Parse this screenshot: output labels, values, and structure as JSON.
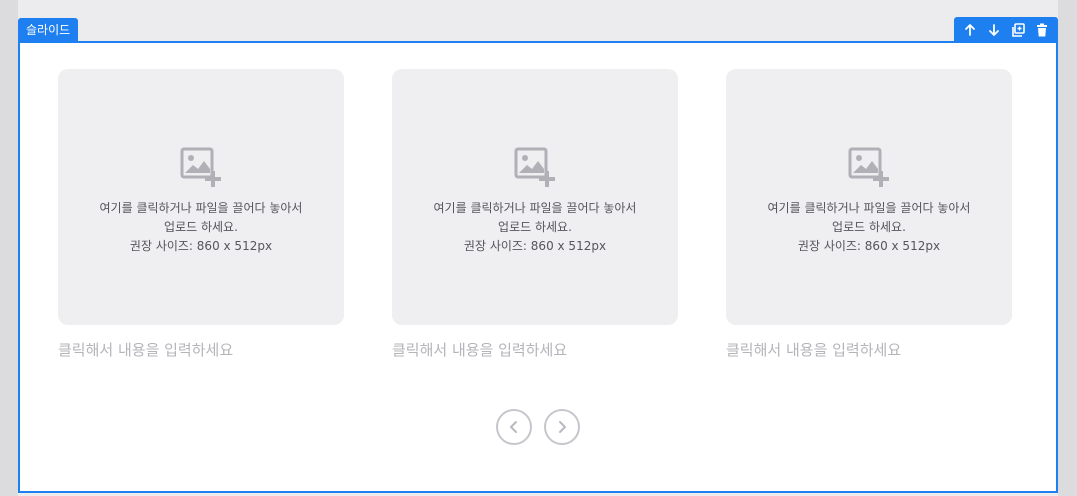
{
  "block": {
    "tag_label": "슬라이드"
  },
  "toolbar": {
    "items": [
      {
        "icon": "arrow-up-icon"
      },
      {
        "icon": "arrow-down-icon"
      },
      {
        "icon": "duplicate-icon"
      },
      {
        "icon": "trash-icon"
      }
    ]
  },
  "slides": [
    {
      "upload_line1": "여기를 클릭하거나 파일을 끌어다 놓아서",
      "upload_line2": "업로드 하세요.",
      "upload_line3": "권장 사이즈: 860 x 512px",
      "caption_placeholder": "클릭해서 내용을 입력하세요"
    },
    {
      "upload_line1": "여기를 클릭하거나 파일을 끌어다 놓아서",
      "upload_line2": "업로드 하세요.",
      "upload_line3": "권장 사이즈: 860 x 512px",
      "caption_placeholder": "클릭해서 내용을 입력하세요"
    },
    {
      "upload_line1": "여기를 클릭하거나 파일을 끌어다 놓아서",
      "upload_line2": "업로드 하세요.",
      "upload_line3": "권장 사이즈: 860 x 512px",
      "caption_placeholder": "클릭해서 내용을 입력하세요"
    }
  ],
  "colors": {
    "accent": "#1e7ff0",
    "placeholder_bg": "#efeff1",
    "caption": "#b4b4ba"
  }
}
